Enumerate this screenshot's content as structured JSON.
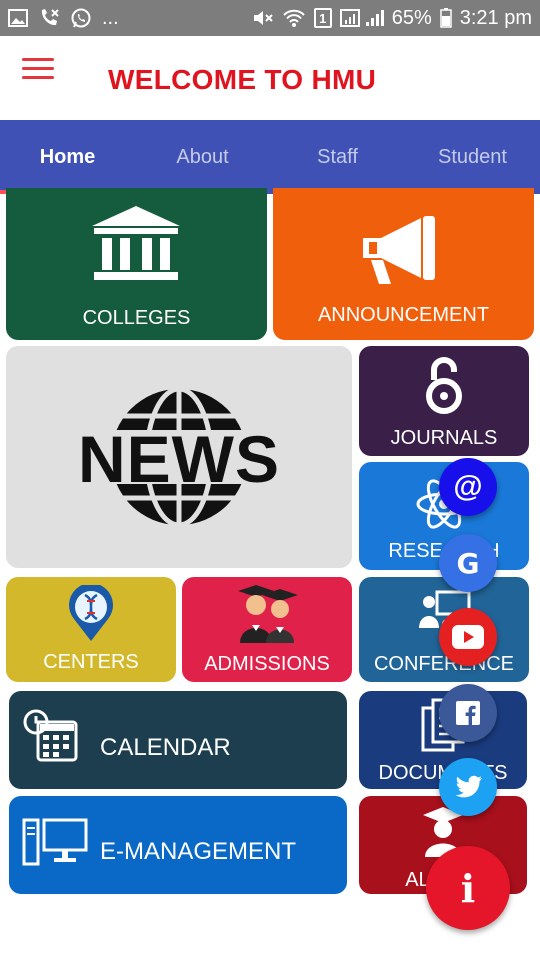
{
  "status_bar": {
    "dots": "...",
    "sim_number": "1",
    "battery": "65%",
    "time": "3:21 pm"
  },
  "app_bar": {
    "title": "WELCOME TO HMU"
  },
  "tabs": [
    {
      "label": "Home",
      "active": true
    },
    {
      "label": "About",
      "active": false
    },
    {
      "label": "Staff",
      "active": false
    },
    {
      "label": "Student",
      "active": false
    }
  ],
  "tiles": {
    "colleges": {
      "label": "COLLEGES",
      "icon": "building-icon",
      "color": "#155c3e"
    },
    "announcement": {
      "label": "ANNOUNCEMENT",
      "icon": "megaphone-icon",
      "color": "#f05f0c"
    },
    "news": {
      "label": "NEWS",
      "icon": "globe-icon",
      "color": "#e0e0e0"
    },
    "journals": {
      "label": "JOURNALS",
      "icon": "open-access-icon",
      "color": "#3a1f48"
    },
    "research": {
      "label": "RESEARCH",
      "icon": "atom-icon",
      "color": "#1a78d8"
    },
    "centers": {
      "label": "CENTERS",
      "icon": "dna-pin-icon",
      "color": "#d3b82b"
    },
    "admissions": {
      "label": "ADMISSIONS",
      "icon": "graduates-icon",
      "color": "#e0224a"
    },
    "conference": {
      "label": "CONFERENCE",
      "icon": "presenter-icon",
      "color": "#216497"
    },
    "calendar": {
      "label": "CALENDAR",
      "icon": "calendar-icon",
      "color": "#1d3e4f"
    },
    "documents": {
      "label": "DOCUMENTS",
      "icon": "documents-icon",
      "color": "#1a3b7e"
    },
    "emanagement": {
      "label": "E-MANAGEMENT",
      "icon": "computer-icon",
      "color": "#0a68c6"
    },
    "alumni": {
      "label": "ALUMNI",
      "icon": "graduate-icon",
      "color": "#a8101c"
    }
  },
  "fabs": {
    "email": {
      "glyph": "@",
      "color": "#1710ea"
    },
    "google": {
      "glyph": "G",
      "color": "#3570e4"
    },
    "youtube": {
      "glyph": "▶",
      "color": "#e52020"
    },
    "facebook": {
      "glyph": "f",
      "color": "#3b5998"
    },
    "twitter": {
      "glyph": "t",
      "color": "#1da1f2"
    },
    "info": {
      "glyph": "i",
      "color": "#e5162a"
    }
  }
}
